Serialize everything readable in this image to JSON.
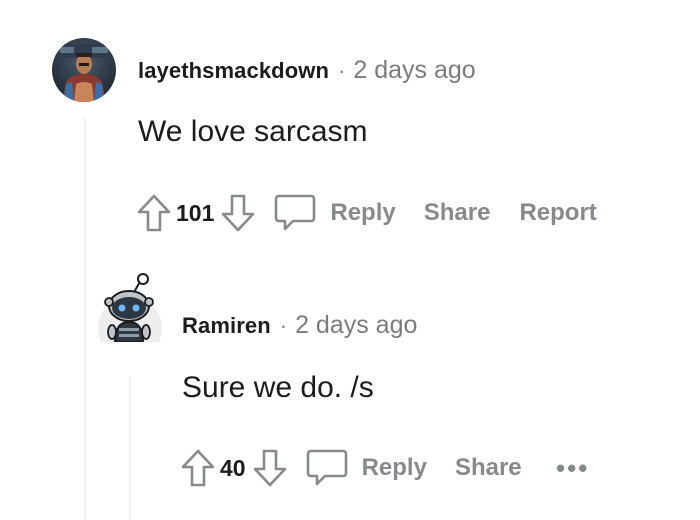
{
  "colors": {
    "text": "#1c1c1c",
    "muted": "#7c7c7c",
    "action": "#878a8c",
    "thread_line": "#edeff1"
  },
  "comments": [
    {
      "username": "layethsmackdown",
      "separator": "·",
      "timestamp": "2 days ago",
      "body": "We love sarcasm",
      "score": "101",
      "actions": {
        "reply": "Reply",
        "share": "Share",
        "report": "Report"
      },
      "avatar": "wrestler-photo-avatar"
    },
    {
      "username": "Ramiren",
      "separator": "·",
      "timestamp": "2 days ago",
      "body": "Sure we do. /s",
      "score": "40",
      "actions": {
        "reply": "Reply",
        "share": "Share",
        "more": "•••"
      },
      "avatar": "snoo-robot-avatar"
    }
  ]
}
